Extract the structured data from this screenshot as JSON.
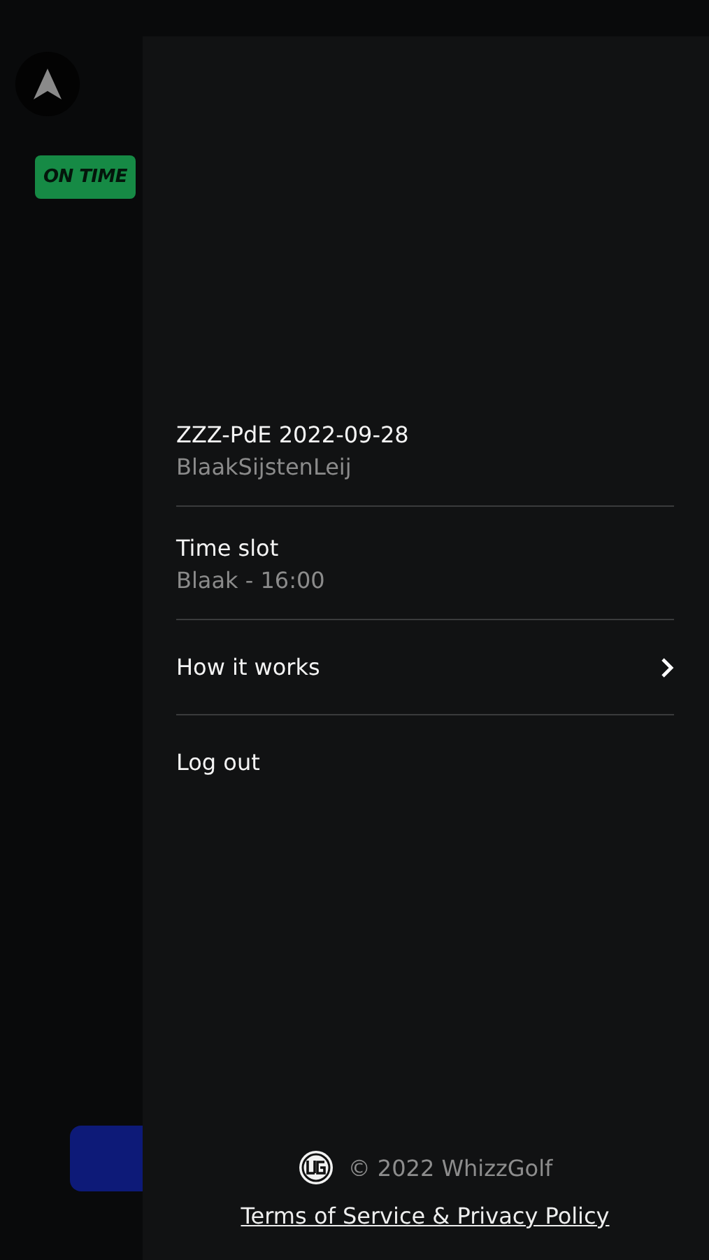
{
  "background": {
    "status_badge": "ON TIME"
  },
  "menu": {
    "items": [
      {
        "kind": "info",
        "title": "ZZZ-PdE 2022-09-28",
        "subtitle": "BlaakSijstenLeij"
      },
      {
        "kind": "info",
        "title": "Time slot",
        "subtitle": "Blaak - 16:00"
      },
      {
        "kind": "link",
        "title": "How it works"
      },
      {
        "kind": "action",
        "title": "Log out"
      }
    ]
  },
  "footer": {
    "copyright": "© 2022 WhizzGolf",
    "legal_link": "Terms of Service & Privacy Policy"
  }
}
